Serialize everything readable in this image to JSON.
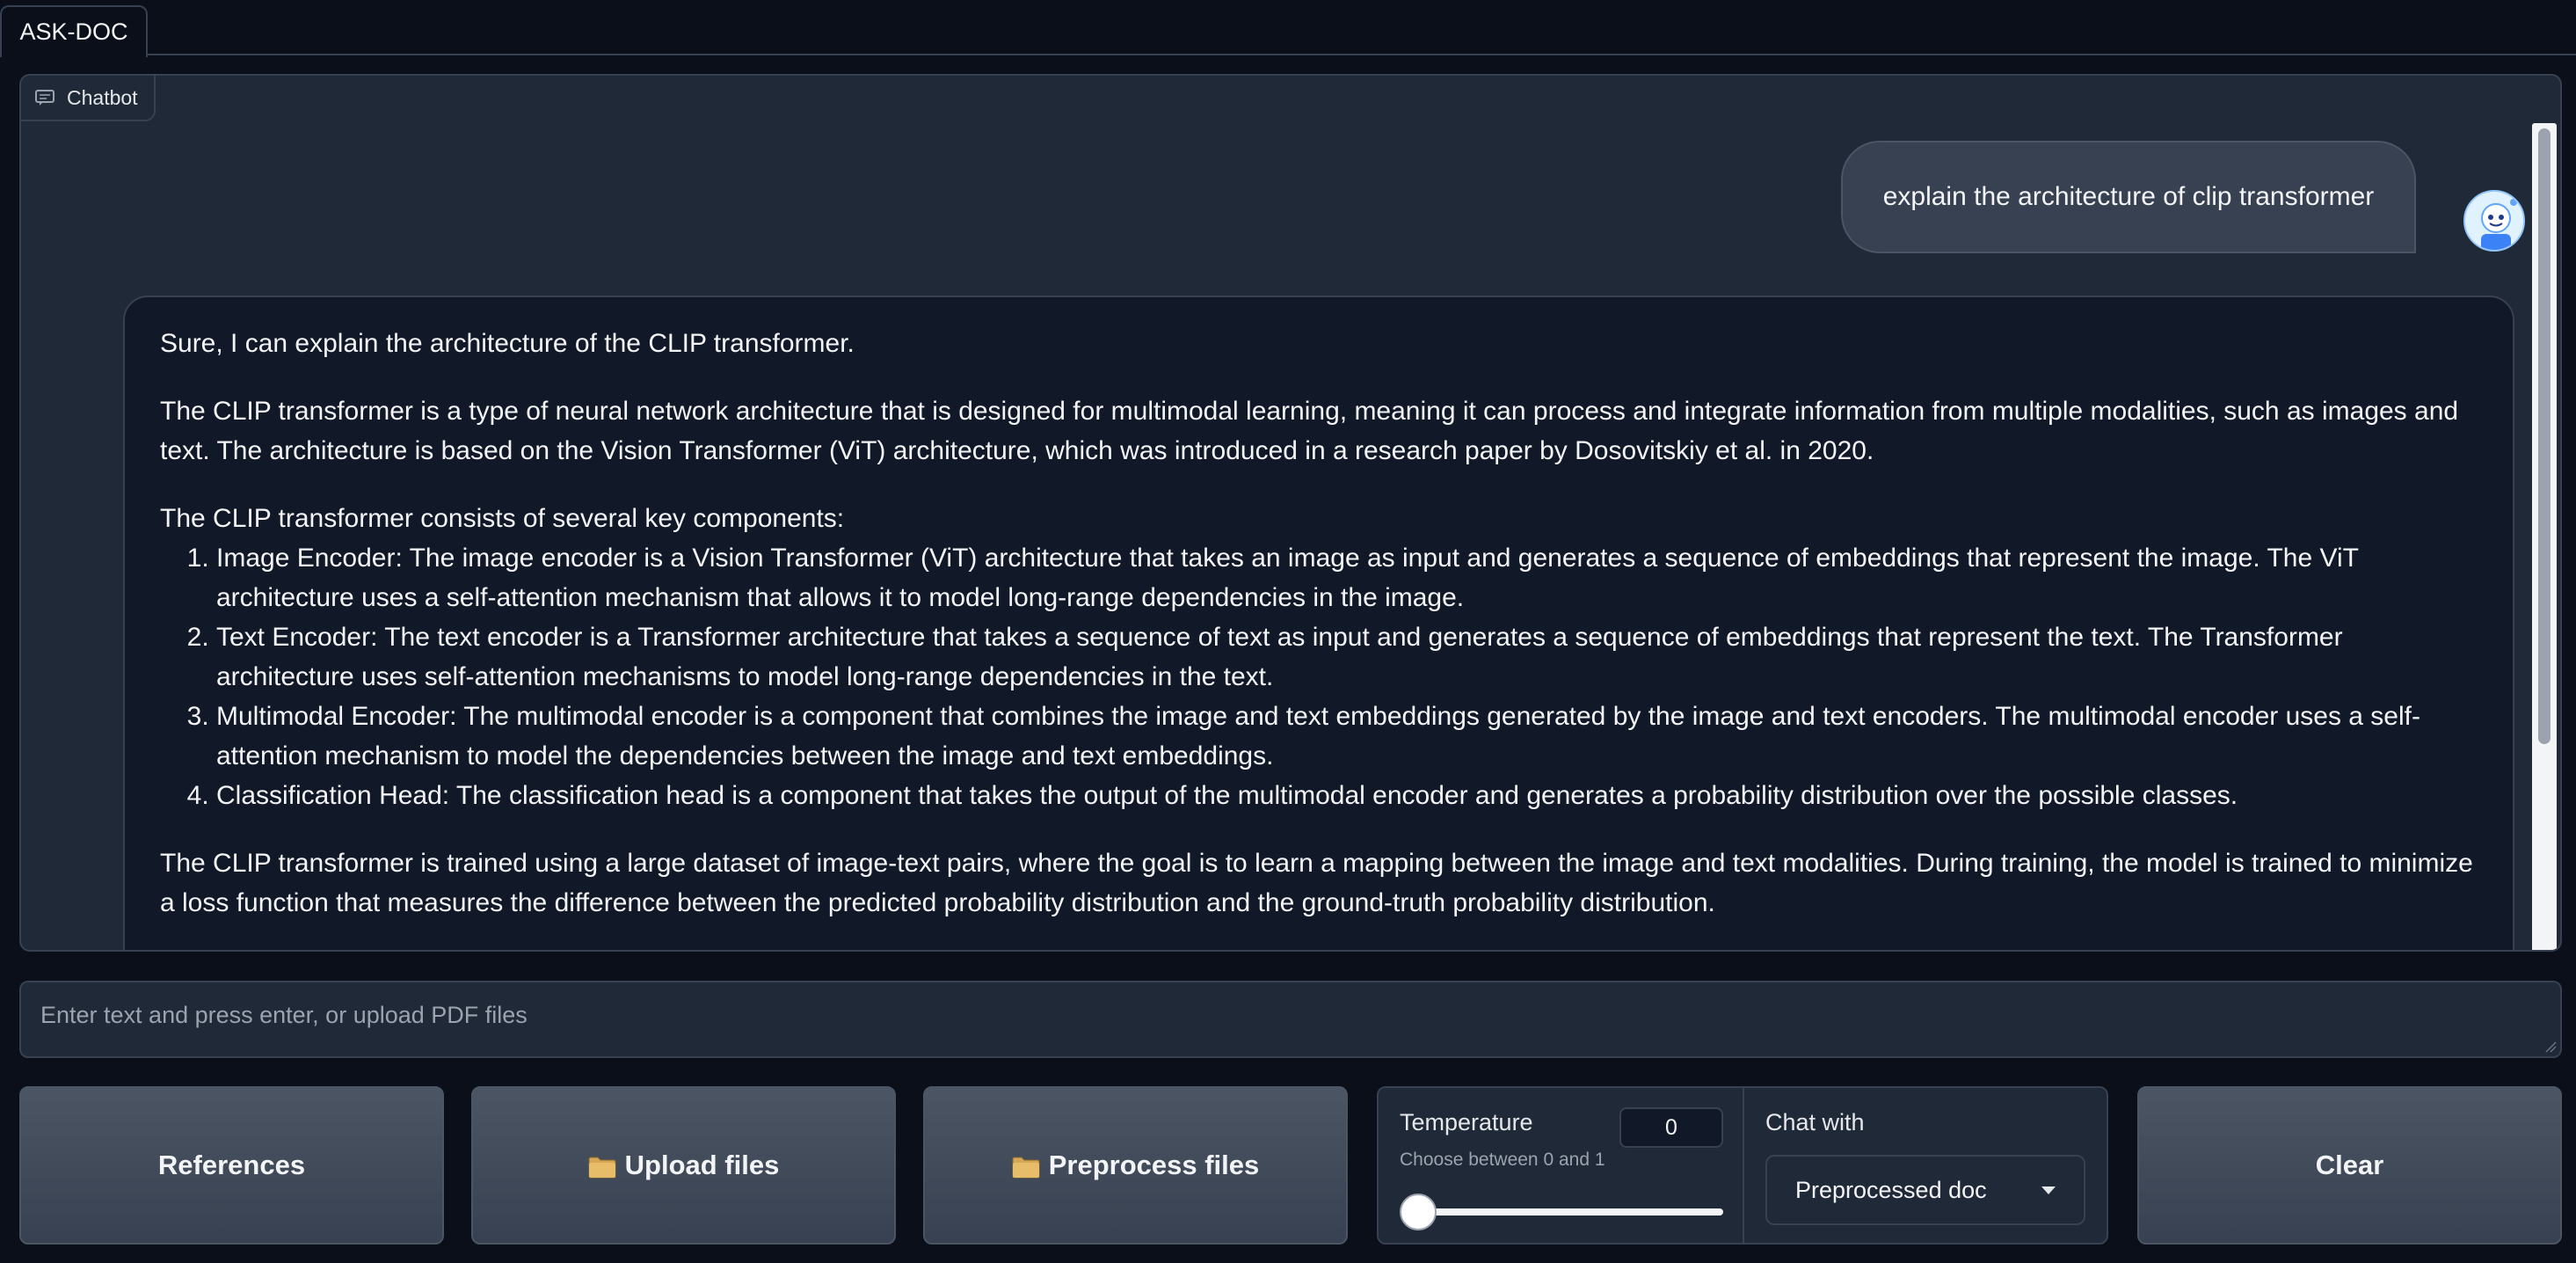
{
  "tabs": [
    {
      "label": "ASK-DOC"
    }
  ],
  "chatbot": {
    "label": "Chatbot",
    "user_message": "explain the architecture of clip transformer",
    "bot_message": {
      "intro": "Sure, I can explain the architecture of the CLIP transformer.",
      "paragraph1": "The CLIP transformer is a type of neural network architecture that is designed for multimodal learning, meaning it can process and integrate information from multiple modalities, such as images and text. The architecture is based on the Vision Transformer (ViT) architecture, which was introduced in a research paper by Dosovitskiy et al. in 2020.",
      "list_intro": "The CLIP transformer consists of several key components:",
      "components": [
        "Image Encoder: The image encoder is a Vision Transformer (ViT) architecture that takes an image as input and generates a sequence of embeddings that represent the image. The ViT architecture uses a self-attention mechanism that allows it to model long-range dependencies in the image.",
        "Text Encoder: The text encoder is a Transformer architecture that takes a sequence of text as input and generates a sequence of embeddings that represent the text. The Transformer architecture uses self-attention mechanisms to model long-range dependencies in the text.",
        "Multimodal Encoder: The multimodal encoder is a component that combines the image and text embeddings generated by the image and text encoders. The multimodal encoder uses a self-attention mechanism to model the dependencies between the image and text embeddings.",
        "Classification Head: The classification head is a component that takes the output of the multimodal encoder and generates a probability distribution over the possible classes."
      ],
      "paragraph2": "The CLIP transformer is trained using a large dataset of image-text pairs, where the goal is to learn a mapping between the image and text modalities. During training, the model is trained to minimize a loss function that measures the difference between the predicted probability distribution and the ground-truth probability distribution."
    }
  },
  "input": {
    "placeholder": "Enter text and press enter, or upload PDF files",
    "value": ""
  },
  "buttons": {
    "references": "References",
    "upload": "Upload files",
    "preprocess": "Preprocess files",
    "clear": "Clear"
  },
  "temperature": {
    "label": "Temperature",
    "info": "Choose between 0 and 1",
    "value": "0",
    "slider_fraction": 0
  },
  "chat_with": {
    "label": "Chat with",
    "selected": "Preprocessed doc"
  },
  "colors": {
    "background": "#0b0f19",
    "panel": "#1f2937",
    "border": "#374151",
    "button": "#4b5563",
    "text": "#f3f4f6"
  }
}
